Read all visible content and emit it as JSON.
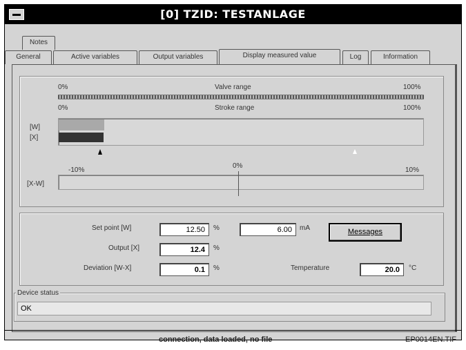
{
  "window": {
    "title": "[0] TZID: TESTANLAGE"
  },
  "tabs": {
    "top_row": [
      "Notes"
    ],
    "bottom_row": [
      "General",
      "Active variables",
      "Output variables",
      "Display measured value",
      "Log",
      "Information"
    ],
    "active": "Display measured value"
  },
  "ranges": {
    "valve_left": "0%",
    "valve_title": "Valve range",
    "valve_right": "100%",
    "stroke_left": "0%",
    "stroke_title": "Stroke range",
    "stroke_right": "100%"
  },
  "bars": {
    "w_label": "[W]",
    "x_label": "[X]",
    "w_fill_percent": 12.5,
    "x_fill_percent": 12.4,
    "w_color": "#a9a9a9",
    "x_color": "#333333"
  },
  "deviation": {
    "left": "-10%",
    "center": "0%",
    "right": "10%",
    "label": "[X-W]"
  },
  "values": {
    "setpoint_label": "Set point [W]",
    "setpoint_value": "12.50",
    "setpoint_unit": "%",
    "ma_value": "6.00",
    "ma_unit": "mA",
    "output_label": "Output [X]",
    "output_value": "12.4",
    "output_unit": "%",
    "deviation_label": "Deviation [W-X]",
    "deviation_value": "0.1",
    "deviation_unit": "%",
    "temperature_label": "Temperature",
    "temperature_value": "20.0",
    "temperature_unit": "°C",
    "messages_button": "Messages"
  },
  "device_status": {
    "label": "Device status",
    "value": "OK"
  },
  "status_bar": {
    "text": "connection, data loaded, no file"
  },
  "figure_label": "EP0014EN.TIF"
}
